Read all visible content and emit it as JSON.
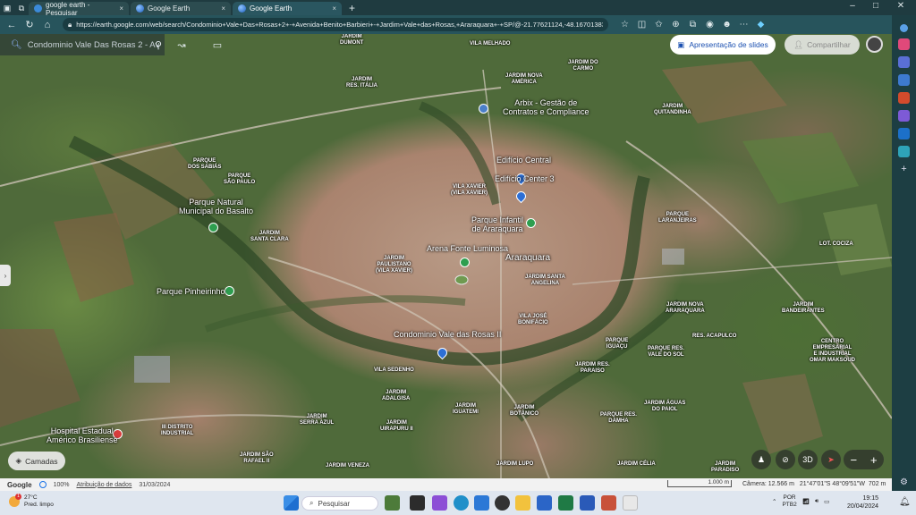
{
  "browser": {
    "tabs": [
      {
        "title": "google earth - Pesquisar",
        "close": "×",
        "active": false
      },
      {
        "title": "Google Earth",
        "close": "×",
        "active": false
      },
      {
        "title": "Google Earth",
        "close": "×",
        "active": true
      }
    ],
    "new_tab": "+",
    "url": "https://earth.google.com/web/search/Condominio+Vale+Das+Rosas+2+-+Avenida+Benito+Barbieri+-+Jardim+Vale+das+Rosas,+Araraquara+-+SP/@-21.77621124,-48.16701383,685.0228...",
    "window_controls": {
      "minimize": "–",
      "maximize": "□",
      "close": "✕"
    }
  },
  "earth": {
    "search_text": "Condominio Vale Das Rosas 2 - Av",
    "slides_button": "Apresentação de slides",
    "share_button": "Compartilhar",
    "layers_button": "Camadas",
    "view_3d": "3D",
    "zoom_out": "−",
    "zoom_in": "+",
    "side_handle": "›"
  },
  "map_labels": {
    "jardim_dumont": "JARDIM\nDUMONT",
    "vila_melhado": "VILA MELHADO",
    "jardim_res_italia": "JARDIM\nRES. ITÁLIA",
    "jardim_nova_america": "JARDIM NOVA\nAMÉRICA",
    "jardim_do_carmo": "JARDIM DO\nCARMO",
    "jardim_quitandinha": "JARDIM\nQUITANDINHA",
    "parque_dos_sabias": "PARQUE\nDOS SABIÁS",
    "parque_sao_paulo": "PARQUE\nSÃO PAULO",
    "vila_xavier": "VILA XAVIER\n(VILA XAVIER)",
    "parque_laranjeiras": "PARQUE\nLARANJEIRAS",
    "jardim_santa_clara": "JARDIM\nSANTA CLARA",
    "jardim_paulistano": "JARDIM\nPAULISTANO\n(VILA XAVIER)",
    "lot_cociza": "LOT. COCIZA",
    "jardim_santa_angelina": "JARDIM SANTA\nANGELINA",
    "jardim_bandeirantes": "JARDIM\nBANDEIRANTES",
    "vila_jose_bonifacio": "VILA JOSÉ\nBONIFÁCIO",
    "jardim_nova_araraquara": "JARDIM NOVA\nARARAQUARA",
    "res_acapulco": "RES. ACAPULCO",
    "parque_iguacu": "PARQUE\nIGUAÇU",
    "parque_res_vale_do_sol": "PARQUE RES.\nVALE DO SOL",
    "centro_empresarial": "CENTRO\nEMPRESARIAL\nE INDUSTRIAL\nOMAR MAKSOUD",
    "vila_sedenho": "VILA SEDENHO",
    "jardim_res_paraiso": "JARDIM RES.\nPARAISO",
    "jardim_adalgisa": "JARDIM\nADALGISA",
    "jardim_botanico": "JARDIM\nBOTÂNICO",
    "parque_res_damha": "PARQUE RES.\nDAMHA",
    "jardim_aguas_do_paiol": "JARDIM ÁGUAS\nDO PAIOL",
    "jardim_serra_azul": "JARDIM\nSERRA AZUL",
    "jardim_iguatemi": "JARDIM\nIGUATEMI",
    "jardim_uirapuru": "JARDIM\nUIRAPURU II",
    "distrito_industrial": "III DISTRITO\nINDUSTRIAL",
    "jardim_sao_rafael": "JARDIM SÃO\nRAFAEL II",
    "jardim_veneza": "JARDIM VENEZA",
    "jardim_lupo": "JARDIM LUPO",
    "jardim_celia": "JARDIM CÉLIA",
    "jardim_paradiso": "JARDIM\nPARADISO"
  },
  "places": {
    "arbix": "Arbix - Gestão de\nContratos e Compliance",
    "edificio_central": "Edifício Central",
    "edificio_center3": "Edifício Center 3",
    "parque_natural": "Parque Natural\nMunicipal do Basalto",
    "parque_infantil": "Parque Infantil\nde Araraquara",
    "arena_fonte": "Arena Fonte Luminosa",
    "araraquara": "Araraquara",
    "parque_pinheirinho": "Parque Pinheirinho",
    "condominio": "Condominio Vale das Rosas II",
    "hospital": "Hospital Estadual\nAmérico Brasiliense"
  },
  "status_bar": {
    "brand": "Google",
    "zoom_pct": "100%",
    "attribution": "Atribuição de dados",
    "date": "31/03/2024",
    "scale": "1.000 m",
    "camera": "Câmera: 12.566 m",
    "coords": "21°47'01\"S 48°09'51\"W",
    "elevation": "702 m"
  },
  "taskbar": {
    "weather_temp": "27°C",
    "weather_desc": "Pred. limpo",
    "weather_badge": "1",
    "search_placeholder": "Pesquisar",
    "lang": "POR",
    "lang2": "PTB2",
    "time": "19:15",
    "date": "20/04/2024"
  },
  "colors": {
    "accent": "#1a73e8",
    "pin": "#2d6fd6",
    "park_poi": "#2e9e4f",
    "hospital_poi": "#d93c3c",
    "browser_chrome": "#27545c"
  }
}
